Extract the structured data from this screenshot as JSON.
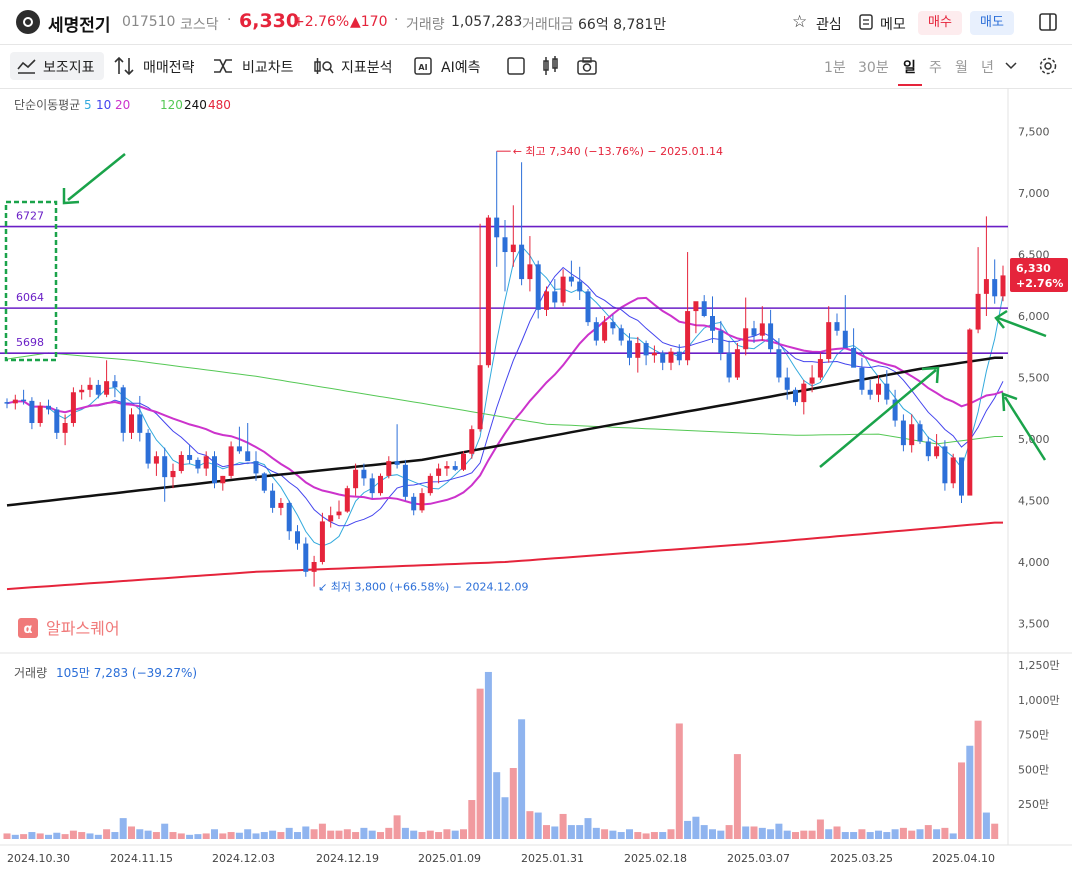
{
  "header": {
    "stock_name": "세명전기",
    "stock_code": "017510",
    "market": "코스닥",
    "price": "6,330",
    "change_pct": "+2.76%",
    "change_abs": "▲170",
    "volume_label": "거래량",
    "volume": "1,057,283",
    "amount_label": "거래대금",
    "amount": "66억 8,781만",
    "watch_label": "관심",
    "memo_label": "메모",
    "buy_label": "매수",
    "sell_label": "매도"
  },
  "toolbar": {
    "indicator_label": "보조지표",
    "strategy_label": "매매전략",
    "compare_label": "비교차트",
    "analysis_label": "지표분석",
    "ai_label": "AI예측",
    "periods": [
      "1분",
      "30분",
      "일",
      "주",
      "월",
      "년"
    ],
    "selected_period": "일"
  },
  "legend": {
    "ma_label": "단순이동평균",
    "ma_periods": [
      "5",
      "10",
      "20",
      "120",
      "240",
      "480"
    ],
    "ma_colors": [
      "#33aadd",
      "#4444ee",
      "#cc33cc",
      "#55c855",
      "#111111",
      "#e5243b"
    ]
  },
  "volume_legend": {
    "label": "거래량",
    "value": "105만 7,283 (−39.27%)"
  },
  "watermark": "알파스퀘어",
  "chart_data": {
    "type": "candlestick",
    "y_ticks": [
      "7,500",
      "7,000",
      "6,500",
      "6,000",
      "5,500",
      "5,000",
      "4,500",
      "4,000",
      "3,500"
    ],
    "volume_ticks": [
      "1,250만",
      "1,000만",
      "750만",
      "500만",
      "250만"
    ],
    "x_labels": [
      "2024.10.30",
      "2024.11.15",
      "2024.12.03",
      "2024.12.19",
      "2025.01.09",
      "2025.01.31",
      "2025.02.18",
      "2025.03.07",
      "2025.03.25",
      "2025.04.10"
    ],
    "ylim": [
      3300,
      7850
    ],
    "vol_ylim": [
      0,
      13300000
    ],
    "horizontal_lines": [
      6727,
      6064,
      5698
    ],
    "hline_labels": [
      "6727",
      "6064",
      "5698"
    ],
    "high_annotation": "최고 7,340 (−13.76%) − 2025.01.14",
    "low_annotation": "최저 3,800 (+66.58%) − 2024.12.09",
    "high_value": 7340,
    "low_value": 3800,
    "last_price_label": "6,330",
    "last_change_label": "+2.76%",
    "up_color": "#e5243b",
    "down_color": "#2c6fd8",
    "accent_green": "#1aa34a",
    "hline_color": "#6a1fc6",
    "ohlc": [
      [
        5300,
        5330,
        5250,
        5290
      ],
      [
        5290,
        5360,
        5240,
        5320
      ],
      [
        5320,
        5400,
        5280,
        5310
      ],
      [
        5310,
        5340,
        5080,
        5130
      ],
      [
        5130,
        5300,
        5100,
        5270
      ],
      [
        5270,
        5320,
        5200,
        5240
      ],
      [
        5240,
        5260,
        5000,
        5050
      ],
      [
        5050,
        5200,
        4950,
        5130
      ],
      [
        5130,
        5420,
        5100,
        5380
      ],
      [
        5380,
        5440,
        5320,
        5400
      ],
      [
        5400,
        5500,
        5340,
        5440
      ],
      [
        5440,
        5480,
        5330,
        5360
      ],
      [
        5360,
        5640,
        5340,
        5470
      ],
      [
        5470,
        5520,
        5340,
        5420
      ],
      [
        5420,
        5440,
        4980,
        5050
      ],
      [
        5050,
        5250,
        5000,
        5200
      ],
      [
        5200,
        5350,
        4980,
        5050
      ],
      [
        5050,
        5080,
        4760,
        4800
      ],
      [
        4800,
        4900,
        4700,
        4860
      ],
      [
        4860,
        4930,
        4490,
        4690
      ],
      [
        4690,
        4800,
        4600,
        4740
      ],
      [
        4740,
        4900,
        4720,
        4870
      ],
      [
        4870,
        4950,
        4800,
        4830
      ],
      [
        4830,
        4850,
        4720,
        4760
      ],
      [
        4760,
        4900,
        4700,
        4860
      ],
      [
        4860,
        4900,
        4600,
        4640
      ],
      [
        4640,
        4700,
        4580,
        4700
      ],
      [
        4700,
        4980,
        4680,
        4940
      ],
      [
        4940,
        5100,
        4880,
        4900
      ],
      [
        4900,
        5130,
        4850,
        4820
      ],
      [
        4820,
        4900,
        4660,
        4720
      ],
      [
        4720,
        4730,
        4560,
        4580
      ],
      [
        4580,
        4640,
        4400,
        4440
      ],
      [
        4440,
        4520,
        4380,
        4480
      ],
      [
        4480,
        4500,
        4180,
        4250
      ],
      [
        4250,
        4300,
        4100,
        4150
      ],
      [
        4150,
        4200,
        3880,
        3920
      ],
      [
        3920,
        4050,
        3800,
        4000
      ],
      [
        4000,
        4400,
        3980,
        4330
      ],
      [
        4330,
        4450,
        4280,
        4380
      ],
      [
        4380,
        4500,
        4350,
        4410
      ],
      [
        4410,
        4620,
        4400,
        4600
      ],
      [
        4600,
        4800,
        4540,
        4750
      ],
      [
        4750,
        4800,
        4620,
        4680
      ],
      [
        4680,
        4720,
        4520,
        4560
      ],
      [
        4560,
        4720,
        4540,
        4700
      ],
      [
        4700,
        4860,
        4680,
        4820
      ],
      [
        4820,
        5120,
        4760,
        4790
      ],
      [
        4790,
        4830,
        4500,
        4530
      ],
      [
        4530,
        4560,
        4380,
        4420
      ],
      [
        4420,
        4600,
        4400,
        4560
      ],
      [
        4560,
        4720,
        4540,
        4700
      ],
      [
        4700,
        4800,
        4640,
        4760
      ],
      [
        4760,
        4820,
        4700,
        4780
      ],
      [
        4780,
        4820,
        4740,
        4750
      ],
      [
        4750,
        4900,
        4740,
        4880
      ],
      [
        4880,
        5110,
        4840,
        5080
      ],
      [
        5080,
        6750,
        5060,
        5600
      ],
      [
        5600,
        6820,
        5580,
        6800
      ],
      [
        6800,
        7340,
        6400,
        6640
      ],
      [
        6640,
        6780,
        6200,
        6520
      ],
      [
        6520,
        6900,
        6400,
        6580
      ],
      [
        6580,
        7250,
        6250,
        6300
      ],
      [
        6300,
        6650,
        6200,
        6420
      ],
      [
        6420,
        6450,
        5980,
        6050
      ],
      [
        6050,
        6240,
        6000,
        6200
      ],
      [
        6200,
        6300,
        6060,
        6110
      ],
      [
        6110,
        6380,
        6080,
        6320
      ],
      [
        6320,
        6450,
        6240,
        6280
      ],
      [
        6280,
        6400,
        6130,
        6200
      ],
      [
        6200,
        6220,
        5920,
        5950
      ],
      [
        5950,
        5990,
        5760,
        5800
      ],
      [
        5800,
        6000,
        5780,
        5950
      ],
      [
        5950,
        6010,
        5850,
        5900
      ],
      [
        5900,
        5930,
        5760,
        5800
      ],
      [
        5800,
        5860,
        5600,
        5660
      ],
      [
        5660,
        5830,
        5540,
        5780
      ],
      [
        5780,
        5800,
        5600,
        5680
      ],
      [
        5680,
        5760,
        5620,
        5700
      ],
      [
        5700,
        5720,
        5560,
        5620
      ],
      [
        5620,
        5740,
        5560,
        5710
      ],
      [
        5710,
        5770,
        5600,
        5640
      ],
      [
        5640,
        6520,
        5600,
        6040
      ],
      [
        6040,
        6070,
        5860,
        6120
      ],
      [
        6120,
        6170,
        5990,
        6000
      ],
      [
        6000,
        6160,
        5780,
        5880
      ],
      [
        5880,
        5960,
        5640,
        5700
      ],
      [
        5700,
        5800,
        5460,
        5500
      ],
      [
        5500,
        5780,
        5480,
        5730
      ],
      [
        5730,
        6150,
        5680,
        5900
      ],
      [
        5900,
        5960,
        5780,
        5840
      ],
      [
        5840,
        6080,
        5800,
        5940
      ],
      [
        5940,
        6050,
        5700,
        5730
      ],
      [
        5730,
        5820,
        5460,
        5500
      ],
      [
        5500,
        5580,
        5320,
        5400
      ],
      [
        5400,
        5420,
        5270,
        5300
      ],
      [
        5300,
        5480,
        5200,
        5450
      ],
      [
        5450,
        5600,
        5380,
        5500
      ],
      [
        5500,
        5700,
        5480,
        5650
      ],
      [
        5650,
        6080,
        5620,
        5950
      ],
      [
        5950,
        6020,
        5840,
        5880
      ],
      [
        5880,
        6170,
        5780,
        5740
      ],
      [
        5740,
        5900,
        5620,
        5580
      ],
      [
        5580,
        5660,
        5360,
        5400
      ],
      [
        5400,
        5480,
        5320,
        5360
      ],
      [
        5360,
        5520,
        5300,
        5450
      ],
      [
        5450,
        5560,
        5280,
        5320
      ],
      [
        5320,
        5400,
        5100,
        5150
      ],
      [
        5150,
        5200,
        4900,
        4950
      ],
      [
        4950,
        5200,
        4890,
        5120
      ],
      [
        5120,
        5150,
        4960,
        4980
      ],
      [
        4980,
        5020,
        4820,
        4860
      ],
      [
        4860,
        5040,
        4840,
        4940
      ],
      [
        4940,
        4990,
        4580,
        4640
      ],
      [
        4640,
        4880,
        4600,
        4850
      ],
      [
        4850,
        4650,
        4480,
        4540
      ],
      [
        4540,
        5900,
        4740,
        5890
      ],
      [
        5890,
        6560,
        5860,
        6180
      ],
      [
        6180,
        6810,
        6000,
        6300
      ],
      [
        6300,
        6460,
        6100,
        6160
      ],
      [
        6160,
        6410,
        6120,
        6330
      ]
    ],
    "volumes": [
      [
        400000,
        1
      ],
      [
        300000,
        0
      ],
      [
        350000,
        1
      ],
      [
        500000,
        0
      ],
      [
        400000,
        1
      ],
      [
        300000,
        0
      ],
      [
        450000,
        0
      ],
      [
        350000,
        1
      ],
      [
        600000,
        1
      ],
      [
        500000,
        1
      ],
      [
        400000,
        0
      ],
      [
        300000,
        0
      ],
      [
        700000,
        1
      ],
      [
        500000,
        0
      ],
      [
        1500000,
        0
      ],
      [
        900000,
        1
      ],
      [
        700000,
        0
      ],
      [
        600000,
        0
      ],
      [
        500000,
        1
      ],
      [
        1100000,
        0
      ],
      [
        500000,
        1
      ],
      [
        400000,
        1
      ],
      [
        300000,
        0
      ],
      [
        350000,
        0
      ],
      [
        400000,
        1
      ],
      [
        700000,
        0
      ],
      [
        400000,
        1
      ],
      [
        500000,
        1
      ],
      [
        450000,
        0
      ],
      [
        700000,
        0
      ],
      [
        400000,
        0
      ],
      [
        500000,
        0
      ],
      [
        600000,
        0
      ],
      [
        500000,
        1
      ],
      [
        800000,
        0
      ],
      [
        500000,
        0
      ],
      [
        900000,
        0
      ],
      [
        700000,
        1
      ],
      [
        1100000,
        1
      ],
      [
        600000,
        1
      ],
      [
        600000,
        1
      ],
      [
        700000,
        1
      ],
      [
        500000,
        1
      ],
      [
        800000,
        0
      ],
      [
        600000,
        0
      ],
      [
        500000,
        1
      ],
      [
        800000,
        1
      ],
      [
        1700000,
        1
      ],
      [
        800000,
        0
      ],
      [
        600000,
        0
      ],
      [
        500000,
        1
      ],
      [
        600000,
        1
      ],
      [
        500000,
        1
      ],
      [
        700000,
        1
      ],
      [
        600000,
        0
      ],
      [
        700000,
        1
      ],
      [
        2800000,
        1
      ],
      [
        10800000,
        1
      ],
      [
        12000000,
        0
      ],
      [
        4800000,
        0
      ],
      [
        3000000,
        0
      ],
      [
        5100000,
        1
      ],
      [
        8600000,
        0
      ],
      [
        2000000,
        1
      ],
      [
        1900000,
        0
      ],
      [
        1000000,
        1
      ],
      [
        900000,
        0
      ],
      [
        1800000,
        1
      ],
      [
        1000000,
        0
      ],
      [
        1000000,
        0
      ],
      [
        1500000,
        0
      ],
      [
        800000,
        0
      ],
      [
        700000,
        1
      ],
      [
        600000,
        0
      ],
      [
        500000,
        0
      ],
      [
        700000,
        0
      ],
      [
        500000,
        1
      ],
      [
        400000,
        1
      ],
      [
        500000,
        1
      ],
      [
        500000,
        0
      ],
      [
        700000,
        1
      ],
      [
        8300000,
        1
      ],
      [
        1300000,
        0
      ],
      [
        1600000,
        0
      ],
      [
        1000000,
        0
      ],
      [
        700000,
        0
      ],
      [
        600000,
        0
      ],
      [
        1000000,
        1
      ],
      [
        6100000,
        1
      ],
      [
        900000,
        0
      ],
      [
        900000,
        1
      ],
      [
        800000,
        0
      ],
      [
        700000,
        0
      ],
      [
        1100000,
        0
      ],
      [
        600000,
        0
      ],
      [
        500000,
        1
      ],
      [
        600000,
        1
      ],
      [
        600000,
        1
      ],
      [
        1400000,
        1
      ],
      [
        700000,
        0
      ],
      [
        900000,
        1
      ],
      [
        500000,
        0
      ],
      [
        500000,
        0
      ],
      [
        700000,
        1
      ],
      [
        500000,
        0
      ],
      [
        600000,
        0
      ],
      [
        500000,
        0
      ],
      [
        700000,
        0
      ],
      [
        800000,
        1
      ],
      [
        600000,
        1
      ],
      [
        700000,
        0
      ],
      [
        1000000,
        1
      ],
      [
        700000,
        0
      ],
      [
        800000,
        1
      ],
      [
        400000,
        0
      ],
      [
        5500000,
        1
      ],
      [
        6700000,
        0
      ],
      [
        8500000,
        1
      ],
      [
        1900000,
        0
      ],
      [
        1100000,
        1
      ]
    ]
  }
}
